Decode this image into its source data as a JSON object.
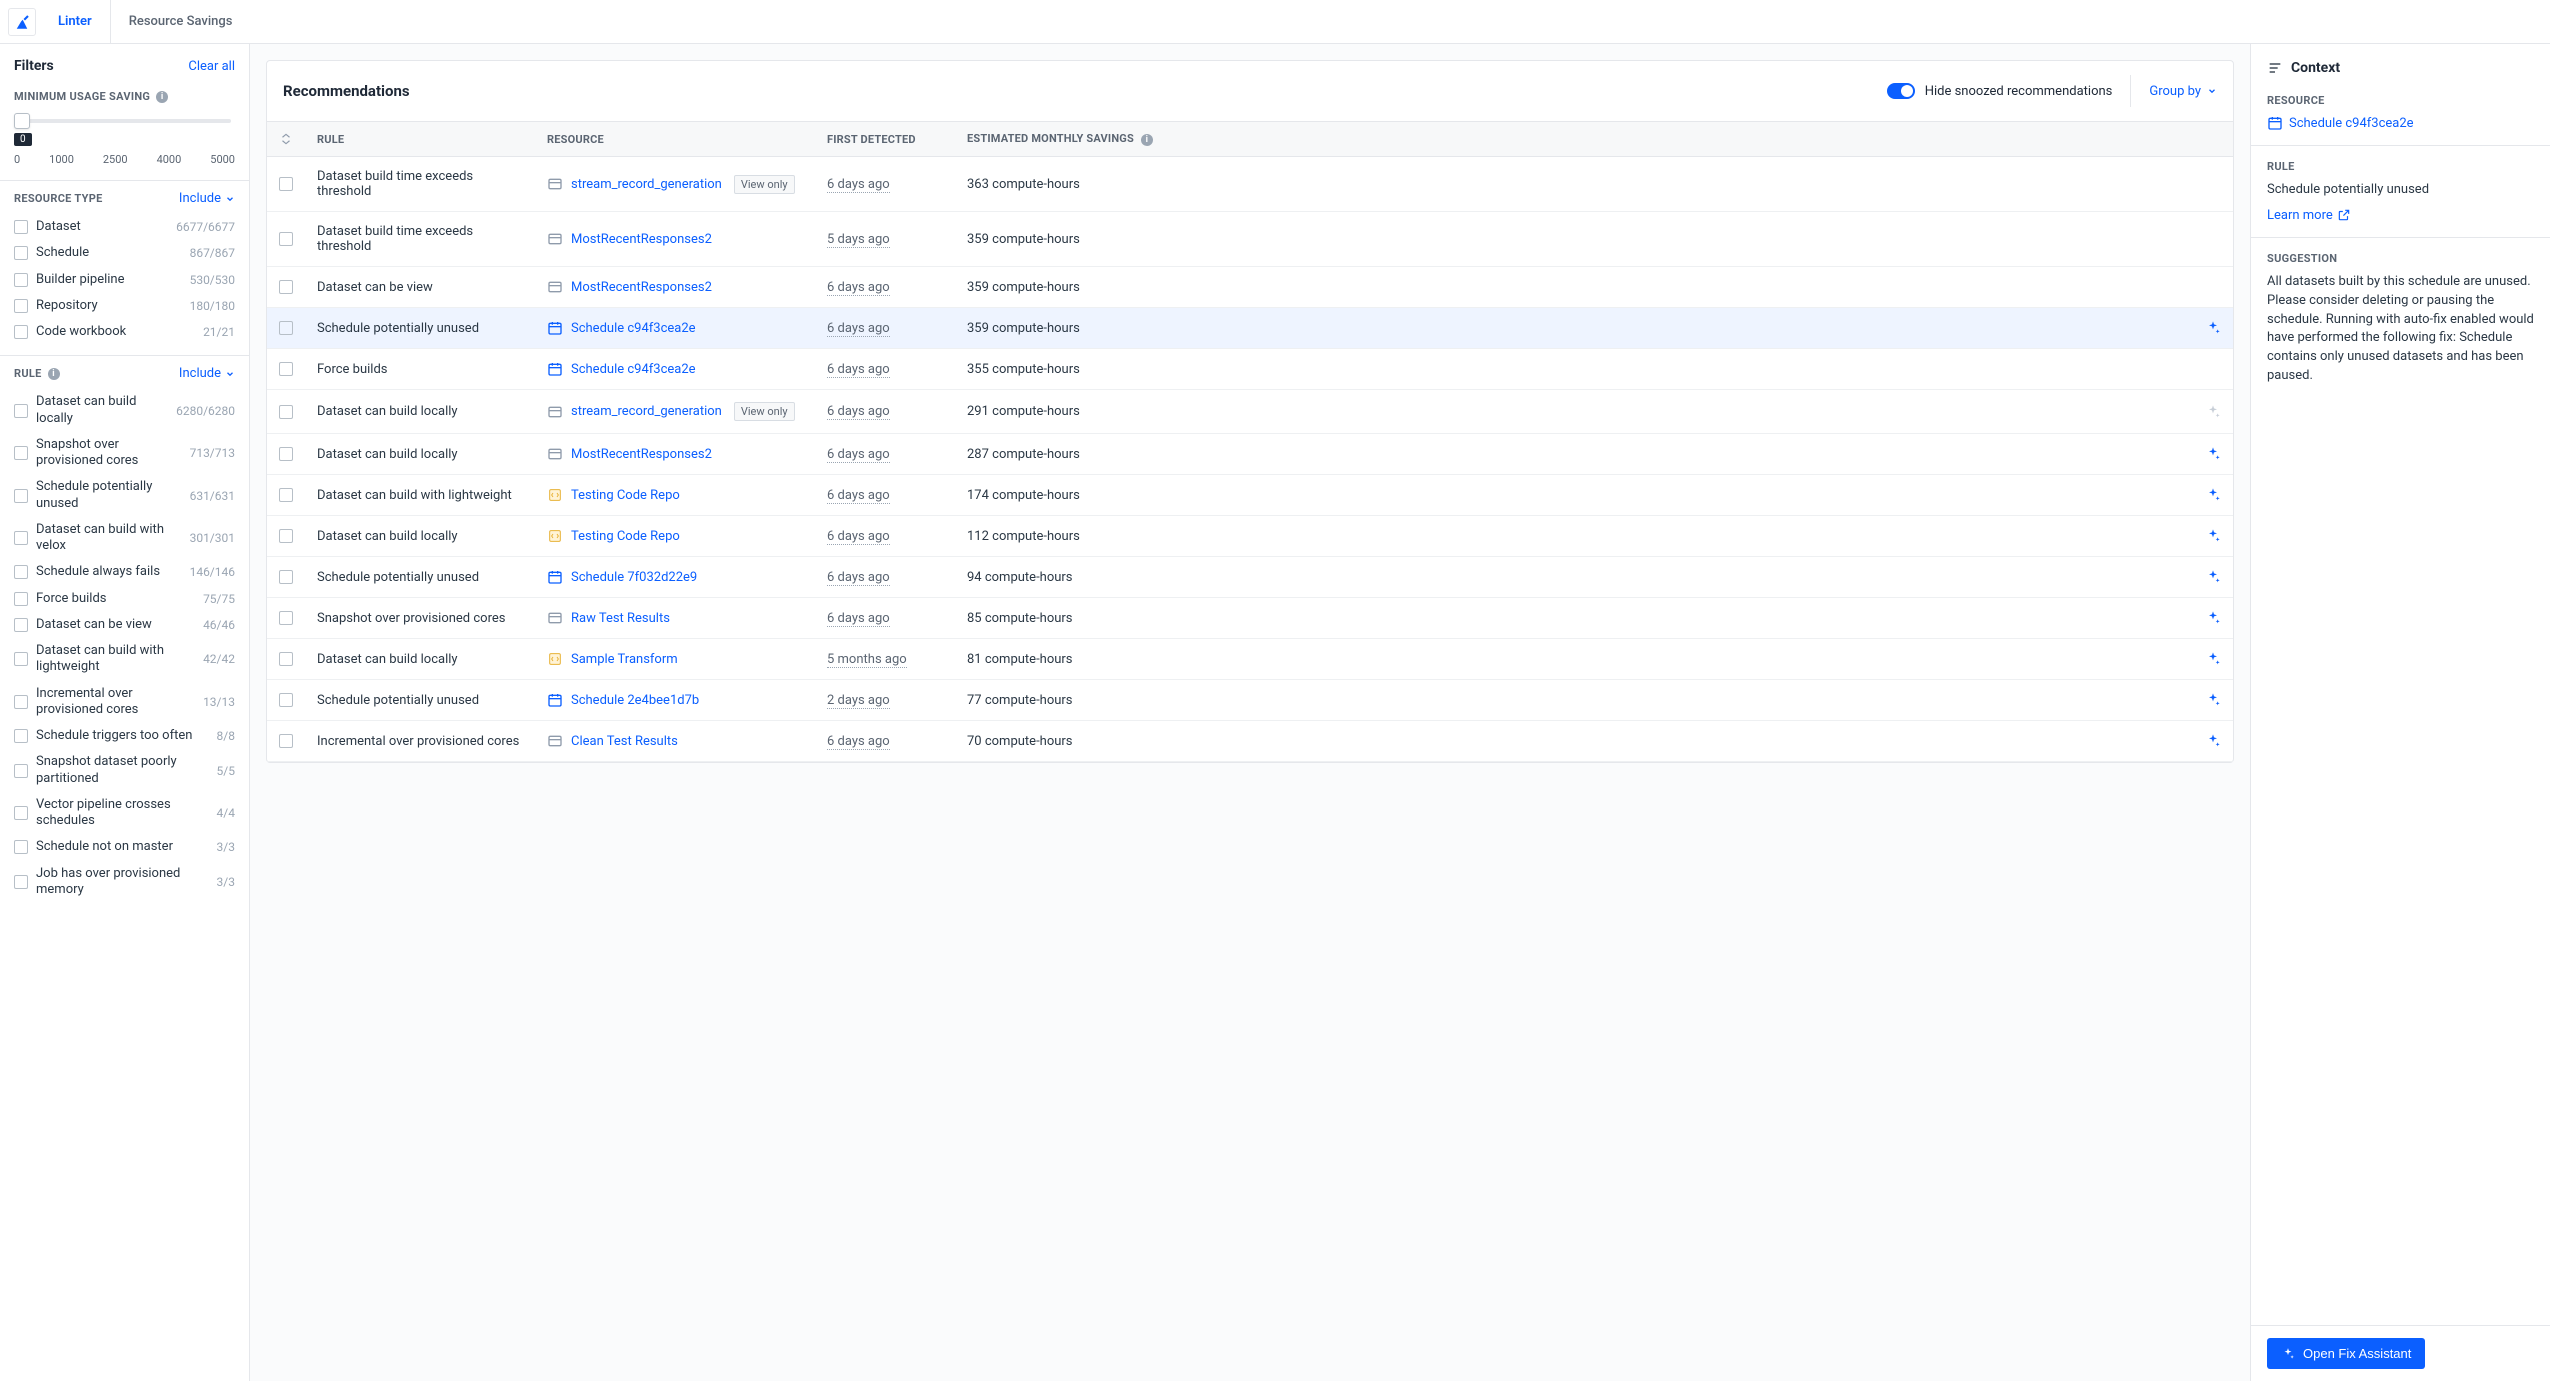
{
  "header": {
    "tabs": [
      "Linter",
      "Resource Savings"
    ],
    "active_tab": "Linter"
  },
  "sidebar": {
    "filters_title": "Filters",
    "clear_all": "Clear all",
    "min_usage_label": "MINIMUM USAGE SAVING",
    "slider_value": "0",
    "slider_ticks": [
      "0",
      "1000",
      "2500",
      "4000",
      "5000"
    ],
    "resource_type_label": "RESOURCE TYPE",
    "include_label": "Include",
    "resource_types": [
      {
        "label": "Dataset",
        "count": "6677/6677"
      },
      {
        "label": "Schedule",
        "count": "867/867"
      },
      {
        "label": "Builder pipeline",
        "count": "530/530"
      },
      {
        "label": "Repository",
        "count": "180/180"
      },
      {
        "label": "Code workbook",
        "count": "21/21"
      }
    ],
    "rule_label": "RULE",
    "rules": [
      {
        "label": "Dataset can build locally",
        "count": "6280/6280"
      },
      {
        "label": "Snapshot over provisioned cores",
        "count": "713/713"
      },
      {
        "label": "Schedule potentially unused",
        "count": "631/631"
      },
      {
        "label": "Dataset can build with velox",
        "count": "301/301"
      },
      {
        "label": "Schedule always fails",
        "count": "146/146"
      },
      {
        "label": "Force builds",
        "count": "75/75"
      },
      {
        "label": "Dataset can be view",
        "count": "46/46"
      },
      {
        "label": "Dataset can build with lightweight",
        "count": "42/42"
      },
      {
        "label": "Incremental over provisioned cores",
        "count": "13/13"
      },
      {
        "label": "Schedule triggers too often",
        "count": "8/8"
      },
      {
        "label": "Snapshot dataset poorly partitioned",
        "count": "5/5"
      },
      {
        "label": "Vector pipeline crosses schedules",
        "count": "4/4"
      },
      {
        "label": "Schedule not on master",
        "count": "3/3"
      },
      {
        "label": "Job has over provisioned memory",
        "count": "3/3"
      }
    ]
  },
  "content": {
    "title": "Recommendations",
    "hide_snoozed_label": "Hide snoozed recommendations",
    "group_by_label": "Group by",
    "columns": {
      "rule": "RULE",
      "resource": "RESOURCE",
      "first_detected": "FIRST DETECTED",
      "savings": "ESTIMATED MONTHLY SAVINGS"
    },
    "rows": [
      {
        "rule": "Dataset build time exceeds threshold",
        "resource": "stream_record_generation",
        "res_icon": "dataset",
        "badge": "View only",
        "first": "6 days ago",
        "savings": "363 compute-hours",
        "action": "none"
      },
      {
        "rule": "Dataset build time exceeds threshold",
        "resource": "MostRecentResponses2",
        "res_icon": "dataset",
        "badge": null,
        "first": "5 days ago",
        "savings": "359 compute-hours",
        "action": "none"
      },
      {
        "rule": "Dataset can be view",
        "resource": "MostRecentResponses2",
        "res_icon": "dataset",
        "badge": null,
        "first": "6 days ago",
        "savings": "359 compute-hours",
        "action": "none"
      },
      {
        "rule": "Schedule potentially unused",
        "resource": "Schedule c94f3cea2e",
        "res_icon": "schedule",
        "badge": null,
        "first": "6 days ago",
        "savings": "359 compute-hours",
        "action": "sparkle",
        "selected": true
      },
      {
        "rule": "Force builds",
        "resource": "Schedule c94f3cea2e",
        "res_icon": "schedule",
        "badge": null,
        "first": "6 days ago",
        "savings": "355 compute-hours",
        "action": "none"
      },
      {
        "rule": "Dataset can build locally",
        "resource": "stream_record_generation",
        "res_icon": "dataset",
        "badge": "View only",
        "first": "6 days ago",
        "savings": "291 compute-hours",
        "action": "sparkle-dim"
      },
      {
        "rule": "Dataset can build locally",
        "resource": "MostRecentResponses2",
        "res_icon": "dataset",
        "badge": null,
        "first": "6 days ago",
        "savings": "287 compute-hours",
        "action": "sparkle"
      },
      {
        "rule": "Dataset can build with lightweight",
        "resource": "Testing Code Repo",
        "res_icon": "repo",
        "badge": null,
        "first": "6 days ago",
        "savings": "174 compute-hours",
        "action": "sparkle"
      },
      {
        "rule": "Dataset can build locally",
        "resource": "Testing Code Repo",
        "res_icon": "repo",
        "badge": null,
        "first": "6 days ago",
        "savings": "112 compute-hours",
        "action": "sparkle"
      },
      {
        "rule": "Schedule potentially unused",
        "resource": "Schedule 7f032d22e9",
        "res_icon": "schedule",
        "badge": null,
        "first": "6 days ago",
        "savings": "94 compute-hours",
        "action": "sparkle"
      },
      {
        "rule": "Snapshot over provisioned cores",
        "resource": "Raw Test Results",
        "res_icon": "dataset",
        "badge": null,
        "first": "6 days ago",
        "savings": "85 compute-hours",
        "action": "sparkle"
      },
      {
        "rule": "Dataset can build locally",
        "resource": "Sample Transform",
        "res_icon": "repo",
        "badge": null,
        "first": "5 months ago",
        "savings": "81 compute-hours",
        "action": "sparkle"
      },
      {
        "rule": "Schedule potentially unused",
        "resource": "Schedule 2e4bee1d7b",
        "res_icon": "schedule",
        "badge": null,
        "first": "2 days ago",
        "savings": "77 compute-hours",
        "action": "sparkle"
      },
      {
        "rule": "Incremental over provisioned cores",
        "resource": "Clean Test Results",
        "res_icon": "dataset",
        "badge": null,
        "first": "6 days ago",
        "savings": "70 compute-hours",
        "action": "sparkle"
      }
    ]
  },
  "context": {
    "title": "Context",
    "resource_label": "RESOURCE",
    "resource_link": "Schedule c94f3cea2e",
    "rule_label": "RULE",
    "rule_text": "Schedule potentially unused",
    "learn_more": "Learn more",
    "suggestion_label": "SUGGESTION",
    "suggestion_text": "All datasets built by this schedule are unused. Please consider deleting or pausing the schedule. Running with auto-fix enabled would have performed the following fix: Schedule contains only unused datasets and has been paused.",
    "open_fix_btn": "Open Fix Assistant"
  }
}
